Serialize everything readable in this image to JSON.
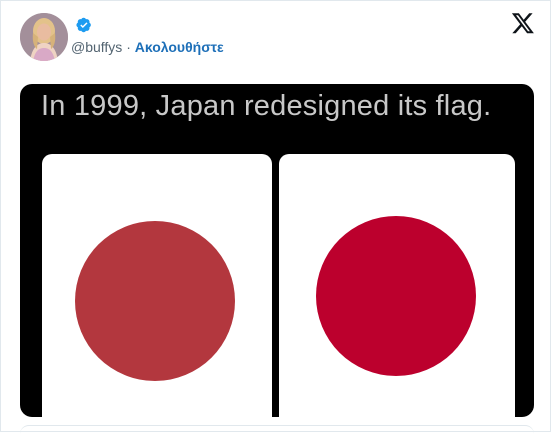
{
  "tweet": {
    "handle": "@buffys",
    "separator": " · ",
    "follow_label": "Ακολουθήστε",
    "verified_icon": "verified-badge-icon",
    "platform_icon": "x-logo-icon",
    "accent_color": "#1d9bf0"
  },
  "media": {
    "caption": "In 1999, Japan redesigned its flag.",
    "left_flag": {
      "disc_color": "#b3373e"
    },
    "right_flag": {
      "disc_color": "#bc002d"
    }
  }
}
